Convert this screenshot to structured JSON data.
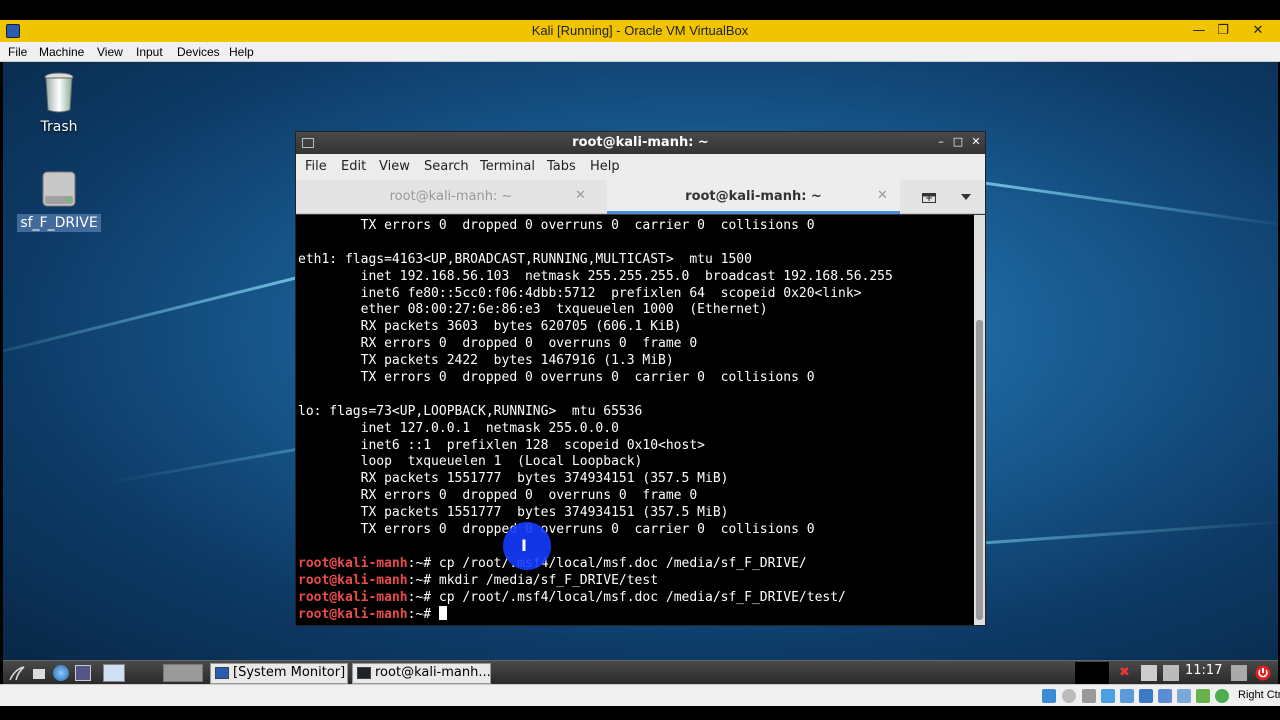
{
  "vbox": {
    "title": "Kali [Running] - Oracle VM VirtualBox",
    "menu": [
      "File",
      "Machine",
      "View",
      "Input",
      "Devices",
      "Help"
    ],
    "host_key": "Right Ctrl"
  },
  "desktop": {
    "icons": [
      {
        "label": "Trash",
        "icon": "trash-icon"
      },
      {
        "label": "sf_F_DRIVE",
        "icon": "drive-icon",
        "selected": true
      }
    ]
  },
  "terminal": {
    "title": "root@kali-manh: ~",
    "menu": [
      "File",
      "Edit",
      "View",
      "Search",
      "Terminal",
      "Tabs",
      "Help"
    ],
    "tabs": [
      {
        "label": "root@kali-manh: ~",
        "active": false
      },
      {
        "label": "root@kali-manh: ~",
        "active": true
      }
    ],
    "lines": [
      {
        "text": "        TX errors 0  dropped 0 overruns 0  carrier 0  collisions 0"
      },
      {
        "text": ""
      },
      {
        "text": "eth1: flags=4163<UP,BROADCAST,RUNNING,MULTICAST>  mtu 1500"
      },
      {
        "text": "        inet 192.168.56.103  netmask 255.255.255.0  broadcast 192.168.56.255"
      },
      {
        "text": "        inet6 fe80::5cc0:f06:4dbb:5712  prefixlen 64  scopeid 0x20<link>"
      },
      {
        "text": "        ether 08:00:27:6e:86:e3  txqueuelen 1000  (Ethernet)"
      },
      {
        "text": "        RX packets 3603  bytes 620705 (606.1 KiB)"
      },
      {
        "text": "        RX errors 0  dropped 0  overruns 0  frame 0"
      },
      {
        "text": "        TX packets 2422  bytes 1467916 (1.3 MiB)"
      },
      {
        "text": "        TX errors 0  dropped 0 overruns 0  carrier 0  collisions 0"
      },
      {
        "text": ""
      },
      {
        "text": "lo: flags=73<UP,LOOPBACK,RUNNING>  mtu 65536"
      },
      {
        "text": "        inet 127.0.0.1  netmask 255.0.0.0"
      },
      {
        "text": "        inet6 ::1  prefixlen 128  scopeid 0x10<host>"
      },
      {
        "text": "        loop  txqueuelen 1  (Local Loopback)"
      },
      {
        "text": "        RX packets 1551777  bytes 374934151 (357.5 MiB)"
      },
      {
        "text": "        RX errors 0  dropped 0  overruns 0  frame 0"
      },
      {
        "text": "        TX packets 1551777  bytes 374934151 (357.5 MiB)"
      },
      {
        "text": "        TX errors 0  dropped 0 overruns 0  carrier 0  collisions 0"
      },
      {
        "text": ""
      },
      {
        "prompt": "root@kali-manh",
        "suffix": ":~# ",
        "text": "cp /root/.msf4/local/msf.doc /media/sf_F_DRIVE/"
      },
      {
        "prompt": "root@kali-manh",
        "suffix": ":~# ",
        "text": "mkdir /media/sf_F_DRIVE/test"
      },
      {
        "prompt": "root@kali-manh",
        "suffix": ":~# ",
        "text": "cp /root/.msf4/local/msf.doc /media/sf_F_DRIVE/test/"
      },
      {
        "prompt": "root@kali-manh",
        "suffix": ":~# ",
        "text": "",
        "cursor": true
      }
    ]
  },
  "taskbar": {
    "buttons": [
      {
        "label": "[System Monitor]",
        "icon": "system-monitor-icon"
      },
      {
        "label": "root@kali-manh...",
        "icon": "terminal-icon"
      }
    ],
    "clock": "11:17"
  },
  "colors": {
    "vbox_title": "#f0c400",
    "prompt": "#e84c4c",
    "tab_accent": "#4a90d9",
    "cursor_highlight": "#143cff"
  }
}
